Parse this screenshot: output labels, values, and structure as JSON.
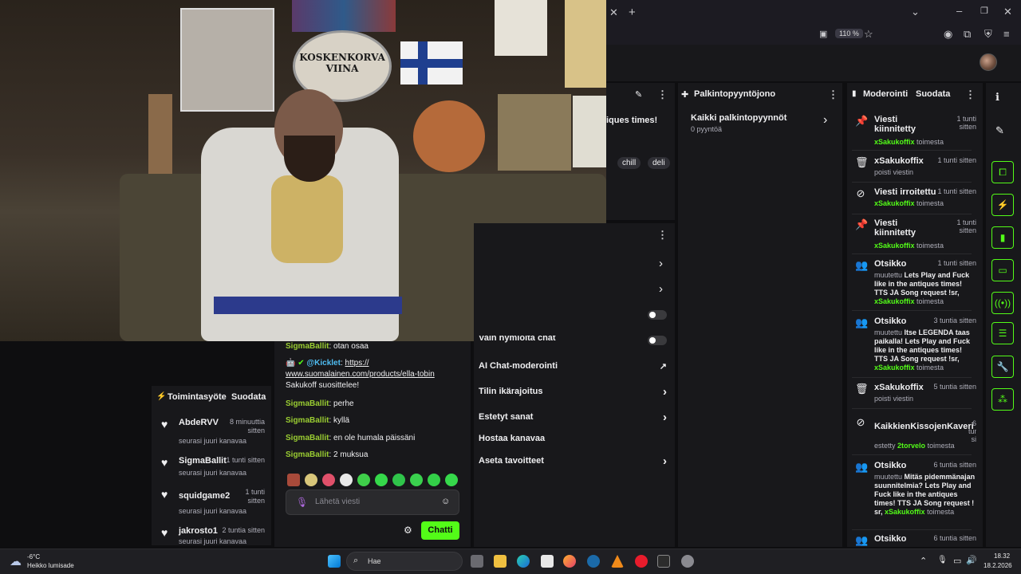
{
  "browser": {
    "zoom": "110 %"
  },
  "webcam": {
    "sign_line1": "KOSKENKORVA",
    "sign_line2": "VIINA"
  },
  "stream_info_partial": {
    "title_fragment": "iques times!",
    "tags": [
      "chill",
      "deli"
    ]
  },
  "activity_feed": {
    "title": "Toimintasyöte",
    "filter_label": "Suodata",
    "items": [
      {
        "name": "AbdeRVV",
        "time": "8 minuuttia sitten",
        "sub": "seurasi juuri kanavaa"
      },
      {
        "name": "SigmaBallit",
        "time": "1 tunti sitten",
        "sub": "seurasi juuri kanavaa"
      },
      {
        "name": "squidgame2",
        "time": "1 tunti sitten",
        "sub": "seurasi juuri kanavaa"
      },
      {
        "name": "jakrosto1",
        "time": "2 tuntia sitten",
        "sub": "seurasi juuri kanavaa"
      }
    ]
  },
  "chat": {
    "messages": [
      {
        "user": "SigmaBallit",
        "text": "otan osaa"
      },
      {
        "user": "@Kicklet",
        "link": "https:// www.suomalainen.com/products/ella-tobin",
        "extra": "Sakukoff suosittelee!"
      },
      {
        "user": "SigmaBallit",
        "text": "perhe"
      },
      {
        "user": "SigmaBallit",
        "text": "kyllä"
      },
      {
        "user": "SigmaBallit",
        "text": "en ole humala päissäni"
      },
      {
        "user": "SigmaBallit",
        "text": "2 muksua"
      }
    ],
    "input_placeholder": "Lähetä viesti",
    "send_label": "Chatti"
  },
  "mod_settings": {
    "rows": [
      {
        "label": "Vain hymiöitä chat"
      },
      {
        "label": "AI Chat-moderointi"
      },
      {
        "label": "Tilin ikärajoitus"
      },
      {
        "label": "Estetyt sanat"
      },
      {
        "label": "Hostaa kanavaa"
      },
      {
        "label": "Aseta tavoitteet"
      }
    ]
  },
  "rewards": {
    "title": "Palkintopyyntöjono",
    "all_label": "Kaikki palkintopyynnöt",
    "count_label": "0 pyyntöä"
  },
  "moderation": {
    "title": "Moderointi",
    "filter_label": "Suodata",
    "items": [
      {
        "icon": "pin-icon",
        "title": "Viesti kiinnitetty",
        "time": "1 tunti sitten",
        "user": "xSakukoffix",
        "suffix": "toimesta"
      },
      {
        "icon": "trash-icon",
        "title": "xSakukoffix",
        "time": "1 tunti sitten",
        "sub": "poisti viestin"
      },
      {
        "icon": "unpin-icon",
        "title": "Viesti irroitettu",
        "time": "1 tunti sitten",
        "user": "xSakukoffix",
        "suffix": "toimesta"
      },
      {
        "icon": "pin-icon",
        "title": "Viesti kiinnitetty",
        "time": "1 tunti sitten",
        "user": "xSakukoffix",
        "suffix": "toimesta"
      },
      {
        "icon": "title-icon",
        "title": "Otsikko",
        "time": "1 tunti sitten",
        "prefix": "muutettu",
        "body": "Lets Play and Fuck like in the antiques times! TTS JA Song request !sr,",
        "user": "xSakukoffix",
        "suffix": "toimesta"
      },
      {
        "icon": "title-icon",
        "title": "Otsikko",
        "time": "3 tuntia sitten",
        "prefix": "muutettu",
        "body": "Itse LEGENDA taas paikalla! Lets Play and Fuck like in the antiques times! TTS JA Song request !sr,",
        "user": "xSakukoffix",
        "suffix": "toimesta"
      },
      {
        "icon": "trash-icon",
        "title": "xSakukoffix",
        "time": "5 tuntia sitten",
        "sub": "poisti viestin"
      },
      {
        "icon": "ban-icon",
        "title": "KaikkienKissojenKaveri",
        "time": "6 tuntia si",
        "prefix": "estetty",
        "user": "2torvelo",
        "suffix": "toimesta"
      },
      {
        "icon": "title-icon",
        "title": "Otsikko",
        "time": "6 tuntia sitten",
        "prefix": "muutettu",
        "body": "Mitäs pidemmänajan suunnitelmia? Lets Play and Fuck like in the antiques times! TTS JA Song request ! sr,",
        "user": "xSakukoffix",
        "suffix": "toimesta"
      },
      {
        "icon": "title-icon",
        "title": "Otsikko",
        "time": "6 tuntia sitten"
      }
    ]
  },
  "taskbar": {
    "weather_temp": "-6°C",
    "weather_desc": "Heikko lumisade",
    "search_placeholder": "Hae",
    "clock_time": "18.32",
    "clock_date": "18.2.2026"
  },
  "colors": {
    "kick_green": "#53fc18",
    "username_green": "#9acd32",
    "panel_bg": "#18181b"
  }
}
